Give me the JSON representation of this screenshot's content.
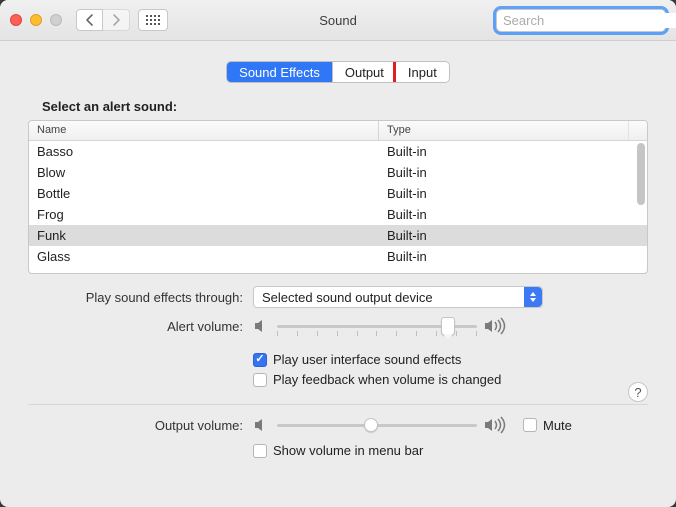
{
  "window": {
    "title": "Sound"
  },
  "search": {
    "placeholder": "Search"
  },
  "tabs": {
    "sound_effects": "Sound Effects",
    "output": "Output",
    "input": "Input",
    "highlighted": "input"
  },
  "section_title": "Select an alert sound:",
  "table": {
    "header_name": "Name",
    "header_type": "Type",
    "rows": [
      {
        "name": "Basso",
        "type": "Built-in"
      },
      {
        "name": "Blow",
        "type": "Built-in"
      },
      {
        "name": "Bottle",
        "type": "Built-in"
      },
      {
        "name": "Frog",
        "type": "Built-in"
      },
      {
        "name": "Funk",
        "type": "Built-in",
        "selected": true
      },
      {
        "name": "Glass",
        "type": "Built-in"
      }
    ]
  },
  "effects_device": {
    "label": "Play sound effects through:",
    "value": "Selected sound output device"
  },
  "alert_volume": {
    "label": "Alert volume:",
    "value_pct": 88
  },
  "play_ui_sounds": {
    "label": "Play user interface sound effects",
    "checked": true
  },
  "play_feedback": {
    "label": "Play feedback when volume is changed",
    "checked": false
  },
  "output_volume": {
    "label": "Output volume:",
    "value_pct": 47
  },
  "mute": {
    "label": "Mute",
    "checked": false
  },
  "show_menu_bar": {
    "label": "Show volume in menu bar",
    "checked": false
  },
  "help_glyph": "?"
}
